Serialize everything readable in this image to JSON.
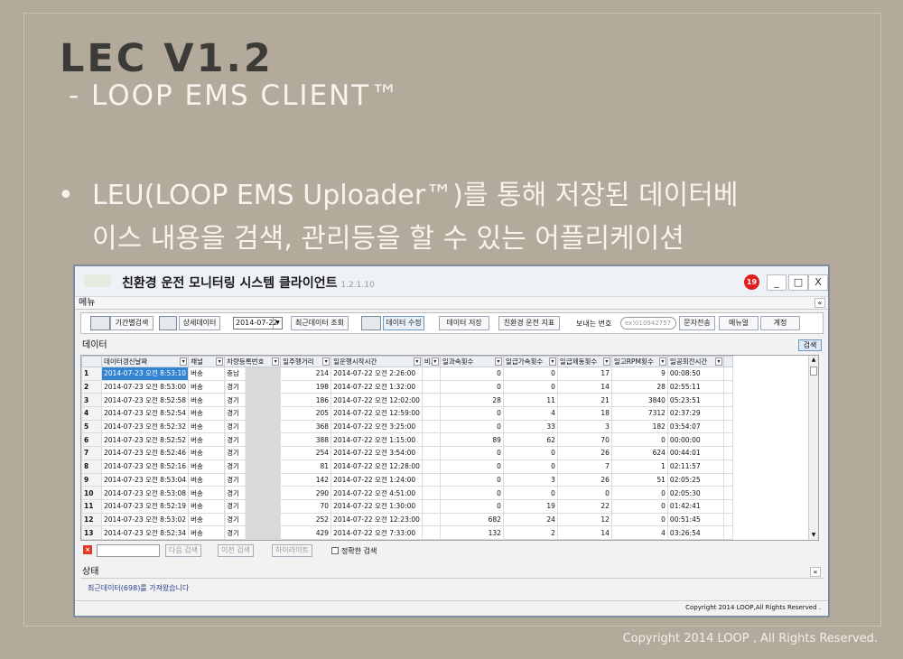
{
  "slide": {
    "title": "LEC V1.2",
    "subtitle": "- LOOP EMS CLIENT™",
    "bullet": "LEU(LOOP EMS Uploader™)를 통해 저장된 데이터베이스 내용을 검색, 관리등을 할 수 있는 어플리케이션",
    "bullet_line1": "LEU(LOOP EMS Uploader™)를 통해 저장된 데이터베",
    "bullet_line2": "이스 내용을 검색, 관리등을 할 수 있는 어플리케이션",
    "footer": "Copyright 2014 LOOP , All Rights Reserved."
  },
  "app": {
    "title": "친환경 운전 모니터링 시스템 클라이언트",
    "version": "1.2.1.10",
    "notification_count": "19",
    "minimize": "_",
    "maximize": "□",
    "close": "X",
    "menu_label": "메뉴",
    "collapse": "«",
    "toolbar": {
      "period_search": "기간별검색",
      "detail_data": "상세데이터",
      "date_value": "2014-07-22",
      "recent_data": "최근데이터 조회",
      "edit_data": "데이터 수정",
      "save_data": "데이터 저장",
      "eco_driving_index": "친환경 운전 지표",
      "sender_number_label": "보내는 번호",
      "phone_placeholder": "ex)010942757",
      "send_sms": "문자전송",
      "manual": "메뉴얼",
      "account": "계정"
    },
    "data_section": "데이터",
    "search": "검색",
    "columns": [
      "",
      "데이터갱신날짜",
      "채널",
      "차량등록번호",
      "일주행거리",
      "일운행시작시간",
      "비고",
      "일과속횟수",
      "일급가속횟수",
      "일급제동횟수",
      "일고RPM횟수",
      "일공회전시간"
    ],
    "rows": [
      [
        "1",
        "2014-07-23 오전 8:53:10",
        "버송",
        "충남",
        "214",
        "2014-07-22 오전 2:26:00",
        "",
        "0",
        "0",
        "17",
        "9",
        "00:08:50"
      ],
      [
        "2",
        "2014-07-23 오전 8:53:00",
        "버송",
        "경기",
        "198",
        "2014-07-22 오전 1:32:00",
        "",
        "0",
        "0",
        "14",
        "28",
        "02:55:11"
      ],
      [
        "3",
        "2014-07-23 오전 8:52:58",
        "버송",
        "경기",
        "186",
        "2014-07-22 오전 12:02:00",
        "",
        "28",
        "11",
        "21",
        "3840",
        "05:23:51"
      ],
      [
        "4",
        "2014-07-23 오전 8:52:54",
        "버송",
        "경기",
        "205",
        "2014-07-22 오전 12:59:00",
        "",
        "0",
        "4",
        "18",
        "7312",
        "02:37:29"
      ],
      [
        "5",
        "2014-07-23 오전 8:52:32",
        "버송",
        "경기",
        "368",
        "2014-07-22 오전 3:25:00",
        "",
        "0",
        "33",
        "3",
        "182",
        "03:54:07"
      ],
      [
        "6",
        "2014-07-23 오전 8:52:52",
        "버송",
        "경기",
        "388",
        "2014-07-22 오전 1:15:00",
        "",
        "89",
        "62",
        "70",
        "0",
        "00:00:00"
      ],
      [
        "7",
        "2014-07-23 오전 8:52:46",
        "버송",
        "경기",
        "254",
        "2014-07-22 오전 3:54:00",
        "",
        "0",
        "0",
        "26",
        "624",
        "00:44:01"
      ],
      [
        "8",
        "2014-07-23 오전 8:52:16",
        "버송",
        "경기",
        "81",
        "2014-07-22 오전 12:28:00",
        "",
        "0",
        "0",
        "7",
        "1",
        "02:11:57"
      ],
      [
        "9",
        "2014-07-23 오전 8:53:04",
        "버송",
        "경기",
        "142",
        "2014-07-22 오전 1:24:00",
        "",
        "0",
        "3",
        "26",
        "51",
        "02:05:25"
      ],
      [
        "10",
        "2014-07-23 오전 8:53:08",
        "버송",
        "경기",
        "290",
        "2014-07-22 오전 4:51:00",
        "",
        "0",
        "0",
        "0",
        "0",
        "02:05:30"
      ],
      [
        "11",
        "2014-07-23 오전 8:52:19",
        "버송",
        "경기",
        "70",
        "2014-07-22 오전 1:30:00",
        "",
        "0",
        "19",
        "22",
        "0",
        "01:42:41"
      ],
      [
        "12",
        "2014-07-23 오전 8:53:02",
        "버송",
        "경기",
        "252",
        "2014-07-22 오전 12:23:00",
        "",
        "682",
        "24",
        "12",
        "0",
        "00:51:45"
      ],
      [
        "13",
        "2014-07-23 오전 8:52:34",
        "버송",
        "경기",
        "429",
        "2014-07-22 오전 7:33:00",
        "",
        "132",
        "2",
        "14",
        "4",
        "03:26:54"
      ]
    ],
    "find": {
      "next": "다음 검색",
      "prev": "이전 검색",
      "highlight": "하이라이트",
      "exact": "정확한 검색"
    },
    "status_label": "상태",
    "status_message": "최근데이터(698)를   가져왔습니다",
    "copyright": "Copyright 2014 LOOP,All Rights Reserved ."
  }
}
